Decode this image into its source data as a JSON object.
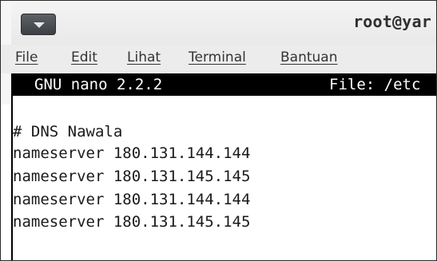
{
  "window": {
    "title": "root@yar"
  },
  "menubar": {
    "items": [
      {
        "label": "File"
      },
      {
        "label": "Edit"
      },
      {
        "label": "Lihat"
      },
      {
        "label": "Terminal"
      },
      {
        "label": "Bantuan"
      }
    ]
  },
  "nano": {
    "version": "GNU nano 2.2.2",
    "file": "File: /etc"
  },
  "editor": {
    "lines": [
      "# DNS Nawala",
      "nameserver 180.131.144.144",
      "nameserver 180.131.145.145",
      "nameserver 180.131.144.144",
      "nameserver 180.131.145.145"
    ]
  }
}
